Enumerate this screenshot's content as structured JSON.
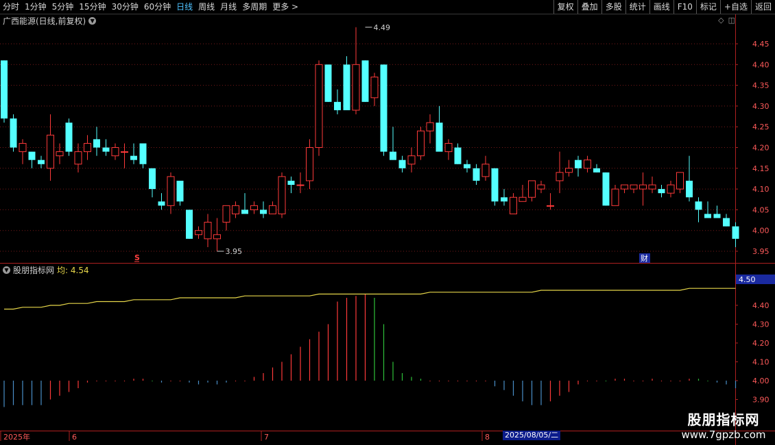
{
  "toolbar": {
    "periods": [
      "分时",
      "1分钟",
      "5分钟",
      "15分钟",
      "30分钟",
      "60分钟",
      "日线",
      "周线",
      "月线",
      "多周期",
      "更多 >"
    ],
    "active_period": "日线",
    "actions": [
      "复权",
      "叠加",
      "多股",
      "统计",
      "画线",
      "F10",
      "标记",
      "+自选",
      "返回"
    ]
  },
  "header": {
    "stock_title": "广西能源(日线,前复权)"
  },
  "indicator": {
    "name": "股朋指标网",
    "avg_label": "均: 4.54",
    "current_box": "4.50"
  },
  "markers": {
    "s_label": "S",
    "cai_label": "财"
  },
  "x_axis": {
    "labels": [
      "2025年",
      "6",
      "7",
      "8"
    ],
    "cursor_date": "2025/08/05/二"
  },
  "watermark": {
    "line1": "股朋指标网",
    "line2": "www.7gpzb.com"
  },
  "colors": {
    "up": "#ff3a3a",
    "down": "#54ffff",
    "ma": "#e8d84a",
    "grid": "#7a1a1a",
    "axis_text": "#ff5a5a",
    "green": "#2ec23a",
    "blue": "#4a8fc8"
  },
  "chart_data": [
    {
      "type": "candlestick",
      "ylim": [
        3.92,
        4.5
      ],
      "y_ticks": [
        3.95,
        4.0,
        4.05,
        4.1,
        4.15,
        4.2,
        4.25,
        4.3,
        4.35,
        4.4,
        4.45
      ],
      "annotations": [
        {
          "label": "4.49",
          "candle": 39,
          "value": 4.49
        },
        {
          "label": "3.95",
          "candle": 23,
          "value": 3.95
        }
      ],
      "ohlc": [
        [
          4.41,
          4.41,
          4.26,
          4.27
        ],
        [
          4.27,
          4.28,
          4.19,
          4.2
        ],
        [
          4.19,
          4.22,
          4.16,
          4.21
        ],
        [
          4.19,
          4.19,
          4.15,
          4.17
        ],
        [
          4.17,
          4.18,
          4.15,
          4.16
        ],
        [
          4.15,
          4.28,
          4.12,
          4.23
        ],
        [
          4.18,
          4.21,
          4.16,
          4.19
        ],
        [
          4.26,
          4.27,
          4.18,
          4.19
        ],
        [
          4.16,
          4.21,
          4.14,
          4.19
        ],
        [
          4.19,
          4.23,
          4.17,
          4.21
        ],
        [
          4.22,
          4.25,
          4.18,
          4.2
        ],
        [
          4.2,
          4.22,
          4.18,
          4.19
        ],
        [
          4.18,
          4.21,
          4.17,
          4.2
        ],
        [
          4.19,
          4.21,
          4.15,
          4.19
        ],
        [
          4.18,
          4.21,
          4.16,
          4.17
        ],
        [
          4.21,
          4.21,
          4.15,
          4.16
        ],
        [
          4.15,
          4.15,
          4.08,
          4.1
        ],
        [
          4.07,
          4.09,
          4.05,
          4.06
        ],
        [
          4.06,
          4.14,
          4.04,
          4.13
        ],
        [
          4.12,
          4.12,
          4.06,
          4.07
        ],
        [
          4.05,
          4.05,
          3.98,
          3.98
        ],
        [
          3.99,
          4.01,
          3.98,
          4.0
        ],
        [
          3.98,
          4.04,
          3.96,
          4.02
        ],
        [
          3.98,
          4.03,
          3.95,
          3.99
        ],
        [
          4.02,
          4.05,
          4.0,
          4.06
        ],
        [
          4.04,
          4.07,
          4.03,
          4.06
        ],
        [
          4.05,
          4.09,
          4.05,
          4.04
        ],
        [
          4.05,
          4.07,
          4.04,
          4.06
        ],
        [
          4.05,
          4.07,
          4.03,
          4.04
        ],
        [
          4.04,
          4.07,
          4.04,
          4.06
        ],
        [
          4.04,
          4.14,
          4.03,
          4.13
        ],
        [
          4.12,
          4.13,
          4.09,
          4.11
        ],
        [
          4.11,
          4.14,
          4.09,
          4.11
        ],
        [
          4.12,
          4.22,
          4.1,
          4.2
        ],
        [
          4.2,
          4.41,
          4.18,
          4.4
        ],
        [
          4.4,
          4.4,
          4.31,
          4.31
        ],
        [
          4.31,
          4.34,
          4.28,
          4.29
        ],
        [
          4.4,
          4.42,
          4.3,
          4.29
        ],
        [
          4.29,
          4.49,
          4.28,
          4.4
        ],
        [
          4.41,
          4.41,
          4.31,
          4.31
        ],
        [
          4.32,
          4.38,
          4.3,
          4.37
        ],
        [
          4.4,
          4.4,
          4.18,
          4.19
        ],
        [
          4.19,
          4.25,
          4.17,
          4.17
        ],
        [
          4.17,
          4.18,
          4.14,
          4.15
        ],
        [
          4.16,
          4.2,
          4.14,
          4.18
        ],
        [
          4.18,
          4.25,
          4.17,
          4.24
        ],
        [
          4.24,
          4.28,
          4.21,
          4.26
        ],
        [
          4.26,
          4.3,
          4.19,
          4.19
        ],
        [
          4.19,
          4.22,
          4.17,
          4.21
        ],
        [
          4.2,
          4.21,
          4.16,
          4.16
        ],
        [
          4.16,
          4.17,
          4.14,
          4.15
        ],
        [
          4.15,
          4.16,
          4.11,
          4.12
        ],
        [
          4.13,
          4.18,
          4.12,
          4.16
        ],
        [
          4.15,
          4.15,
          4.06,
          4.07
        ],
        [
          4.08,
          4.1,
          4.06,
          4.07
        ],
        [
          4.04,
          4.09,
          4.04,
          4.08
        ],
        [
          4.07,
          4.11,
          4.07,
          4.08
        ],
        [
          4.08,
          4.12,
          4.07,
          4.12
        ],
        [
          4.1,
          4.12,
          4.09,
          4.11
        ],
        [
          4.06,
          4.09,
          4.05,
          4.06
        ],
        [
          4.12,
          4.19,
          4.09,
          4.14
        ],
        [
          4.14,
          4.17,
          4.13,
          4.15
        ],
        [
          4.17,
          4.18,
          4.13,
          4.15
        ],
        [
          4.15,
          4.18,
          4.14,
          4.17
        ],
        [
          4.15,
          4.16,
          4.14,
          4.14
        ],
        [
          4.14,
          4.14,
          4.06,
          4.06
        ],
        [
          4.06,
          4.11,
          4.06,
          4.1
        ],
        [
          4.1,
          4.11,
          4.09,
          4.11
        ],
        [
          4.1,
          4.11,
          4.09,
          4.11
        ],
        [
          4.1,
          4.14,
          4.06,
          4.11
        ],
        [
          4.1,
          4.13,
          4.09,
          4.11
        ],
        [
          4.1,
          4.11,
          4.08,
          4.09
        ],
        [
          4.09,
          4.12,
          4.08,
          4.11
        ],
        [
          4.1,
          4.14,
          4.09,
          4.14
        ],
        [
          4.12,
          4.18,
          4.07,
          4.08
        ],
        [
          4.07,
          4.08,
          4.02,
          4.05
        ],
        [
          4.04,
          4.07,
          4.03,
          4.03
        ],
        [
          4.04,
          4.06,
          4.03,
          4.03
        ],
        [
          4.03,
          4.04,
          4.01,
          4.01
        ],
        [
          4.01,
          4.02,
          3.96,
          3.98
        ]
      ]
    },
    {
      "type": "bar",
      "title": "股朋指标网",
      "y_ticks": [
        3.9,
        4.0,
        4.1,
        4.2,
        4.3,
        4.4,
        4.5
      ],
      "ylim": [
        3.86,
        4.52
      ],
      "baseline": 4.0,
      "ma_values": [
        4.38,
        4.38,
        4.39,
        4.39,
        4.39,
        4.4,
        4.4,
        4.41,
        4.41,
        4.41,
        4.42,
        4.42,
        4.42,
        4.42,
        4.43,
        4.43,
        4.43,
        4.43,
        4.43,
        4.44,
        4.44,
        4.44,
        4.44,
        4.44,
        4.44,
        4.44,
        4.45,
        4.45,
        4.45,
        4.45,
        4.45,
        4.45,
        4.45,
        4.45,
        4.46,
        4.46,
        4.46,
        4.46,
        4.46,
        4.46,
        4.46,
        4.46,
        4.46,
        4.46,
        4.46,
        4.46,
        4.47,
        4.47,
        4.47,
        4.47,
        4.47,
        4.47,
        4.47,
        4.47,
        4.47,
        4.47,
        4.47,
        4.47,
        4.48,
        4.48,
        4.48,
        4.48,
        4.48,
        4.48,
        4.48,
        4.48,
        4.48,
        4.48,
        4.48,
        4.48,
        4.48,
        4.48,
        4.48,
        4.48,
        4.49,
        4.49,
        4.49,
        4.49,
        4.49,
        4.49
      ],
      "values": [
        3.86,
        3.87,
        3.87,
        3.87,
        3.87,
        3.9,
        3.92,
        3.94,
        3.96,
        3.99,
        4.0,
        4.0,
        4.0,
        4.0,
        4.01,
        4.01,
        4.0,
        3.99,
        4.0,
        4.0,
        3.99,
        3.98,
        3.99,
        3.98,
        3.99,
        4.0,
        4.0,
        4.02,
        4.04,
        4.07,
        4.1,
        4.14,
        4.18,
        4.22,
        4.26,
        4.3,
        4.42,
        4.44,
        4.45,
        4.46,
        4.44,
        4.3,
        4.1,
        4.04,
        4.02,
        4.01,
        4.0,
        4.0,
        4.0,
        4.0,
        4.0,
        4.0,
        4.0,
        3.97,
        3.95,
        3.92,
        3.89,
        3.87,
        3.87,
        3.89,
        3.92,
        3.94,
        3.98,
        4.0,
        4.0,
        4.0,
        4.01,
        4.01,
        4.0,
        4.0,
        4.01,
        4.0,
        4.0,
        4.0,
        4.01,
        4.01,
        4.0,
        3.99,
        3.98,
        3.96
      ],
      "colors": [
        "b",
        "b",
        "b",
        "b",
        "b",
        "r",
        "r",
        "r",
        "r",
        "r",
        "r",
        "r",
        "r",
        "r",
        "r",
        "r",
        "g",
        "b",
        "r",
        "r",
        "b",
        "b",
        "b",
        "b",
        "b",
        "r",
        "r",
        "r",
        "r",
        "r",
        "r",
        "r",
        "r",
        "r",
        "r",
        "r",
        "r",
        "r",
        "r",
        "r",
        "g",
        "g",
        "g",
        "g",
        "g",
        "g",
        "r",
        "r",
        "r",
        "r",
        "r",
        "r",
        "r",
        "b",
        "b",
        "b",
        "b",
        "b",
        "b",
        "r",
        "r",
        "r",
        "r",
        "r",
        "r",
        "g",
        "r",
        "r",
        "r",
        "r",
        "r",
        "r",
        "r",
        "r",
        "r",
        "g",
        "g",
        "b",
        "b",
        "b"
      ]
    }
  ]
}
